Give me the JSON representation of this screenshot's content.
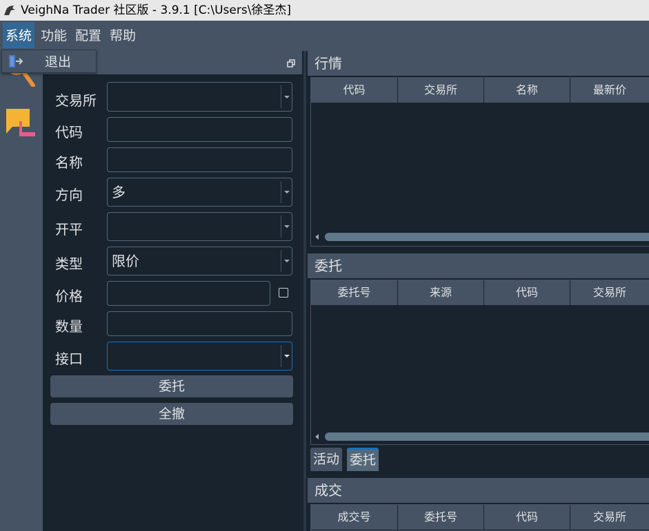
{
  "window": {
    "title": "VeighNa Trader 社区版 - 3.9.1   [C:\\Users\\徐圣杰]"
  },
  "menu": {
    "items": [
      "系统",
      "功能",
      "配置",
      "帮助"
    ],
    "open_menu": {
      "exit_label": "退出"
    }
  },
  "toolbar": {
    "icons": [
      "search-icon",
      "chat-icon"
    ]
  },
  "trade_form": {
    "labels": {
      "exchange": "交易所",
      "symbol": "代码",
      "name": "名称",
      "direction": "方向",
      "offset": "开平",
      "type": "类型",
      "price": "价格",
      "volume": "数量",
      "gateway": "接口"
    },
    "values": {
      "exchange": "",
      "symbol": "",
      "name": "",
      "direction": "多",
      "offset": "",
      "type": "限价",
      "price": "",
      "volume": "",
      "gateway": ""
    },
    "buttons": {
      "send": "委托",
      "cancel_all": "全撤"
    }
  },
  "market_monitor": {
    "title": "行情",
    "columns": [
      "代码",
      "交易所",
      "名称",
      "最新价"
    ]
  },
  "order_monitor": {
    "title": "委托",
    "columns": [
      "委托号",
      "来源",
      "代码",
      "交易所"
    ]
  },
  "tabs": {
    "items": [
      "活动",
      "委托"
    ],
    "selected": "委托"
  },
  "trade_monitor": {
    "title": "成交",
    "columns": [
      "成交号",
      "委托号",
      "代码",
      "交易所"
    ]
  },
  "colors": {
    "background": "#19232d",
    "panel": "#455364",
    "accent": "#1a72bb",
    "menu_active": "#346792",
    "search_icon": "#e8913a",
    "chat_icon_yellow": "#f5b335",
    "chat_icon_pink": "#e85c8c"
  }
}
